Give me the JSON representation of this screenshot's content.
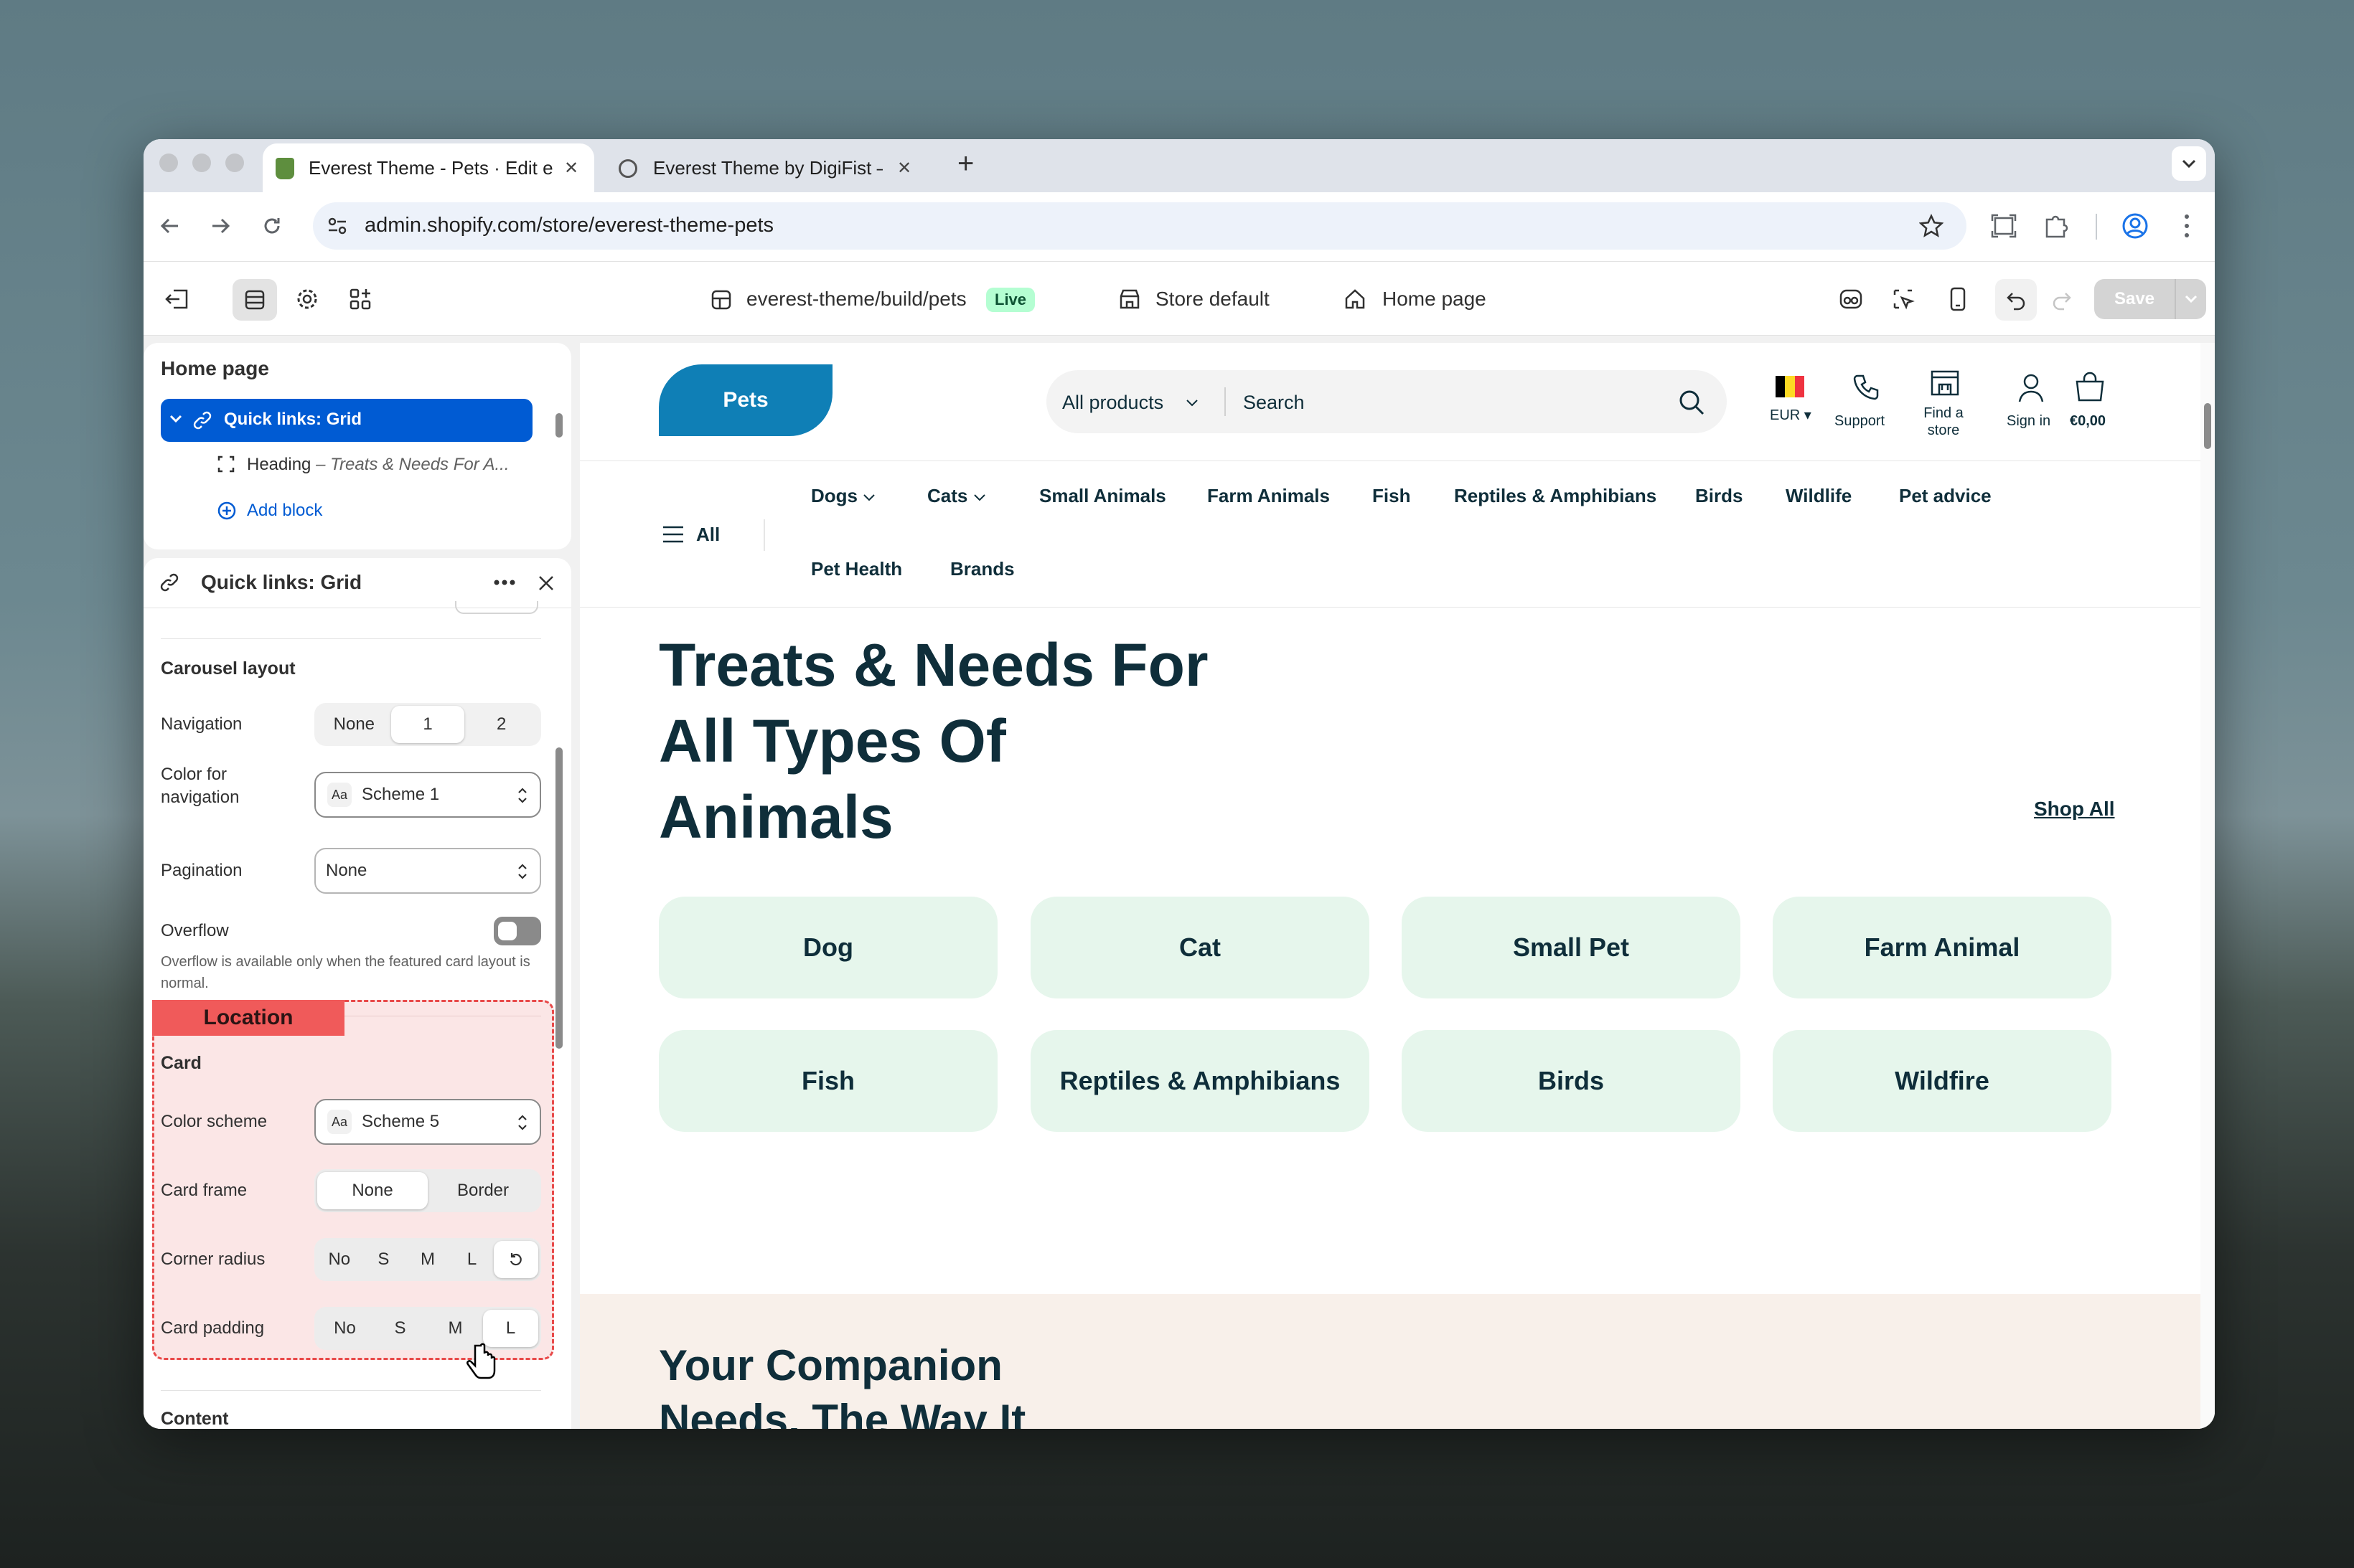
{
  "browser": {
    "tabs": [
      {
        "title": "Everest Theme - Pets · Edit e",
        "close": "✕"
      },
      {
        "title": "Everest Theme by DigiFist – E",
        "close": "✕"
      }
    ],
    "new_tab": "+",
    "url": "admin.shopify.com/store/everest-theme-pets"
  },
  "editor_toolbar": {
    "theme_path": "everest-theme/build/pets",
    "live_badge": "Live",
    "store": "Store default",
    "page": "Home page",
    "save": "Save"
  },
  "sidebar": {
    "tree_title": "Home page",
    "section": "Quick links: Grid",
    "block_label": "Heading",
    "block_detail": "– Treats & Needs For A...",
    "add_block": "Add block"
  },
  "settings": {
    "title": "Quick links: Grid",
    "carousel_heading": "Carousel layout",
    "navigation_label": "Navigation",
    "navigation_options": [
      "None",
      "1",
      "2"
    ],
    "nav_color_label": "Color for navigation",
    "nav_color_value": "Scheme 1",
    "pagination_label": "Pagination",
    "pagination_value": "None",
    "overflow_label": "Overflow",
    "overflow_help": "Overflow is available only when the featured card layout is normal.",
    "location_tag": "Location",
    "card_heading": "Card",
    "color_scheme_label": "Color scheme",
    "color_scheme_value": "Scheme 5",
    "card_frame_label": "Card frame",
    "card_frame_options": [
      "None",
      "Border"
    ],
    "corner_radius_label": "Corner radius",
    "corner_radius_options": [
      "No",
      "S",
      "M",
      "L"
    ],
    "card_padding_label": "Card padding",
    "card_padding_options": [
      "No",
      "S",
      "M",
      "L"
    ],
    "content_heading": "Content",
    "aa": "Aa"
  },
  "store": {
    "logo": "Pets",
    "search_category": "All products",
    "search_placeholder": "Search",
    "currency": "EUR",
    "support": "Support",
    "find_store": "Find a store",
    "sign_in": "Sign in",
    "cart": "€0,00",
    "all_menu": "All",
    "nav_items": [
      "Dogs",
      "Cats",
      "Small Animals",
      "Farm Animals",
      "Fish",
      "Reptiles & Amphibians",
      "Birds",
      "Wildlife",
      "Pet advice"
    ],
    "nav_items_row2": [
      "Pet Health",
      "Brands"
    ],
    "heading_lines": [
      "Treats & Needs For",
      "All Types Of",
      "Animals"
    ],
    "shop_all": "Shop All",
    "quick_links": [
      "Dog",
      "Cat",
      "Small Pet",
      "Farm Animal",
      "Fish",
      "Reptiles & Amphibians",
      "Birds",
      "Wildfire"
    ],
    "next_section_lines": [
      "Your Companion",
      "Needs, The Way It"
    ]
  },
  "colors": {
    "accent_blue": "#005bd3",
    "store_logo": "#0f7fb6",
    "quick_card": "#e6f6ec",
    "location_red": "#f05a5a",
    "live_green": "#b4fed2"
  }
}
